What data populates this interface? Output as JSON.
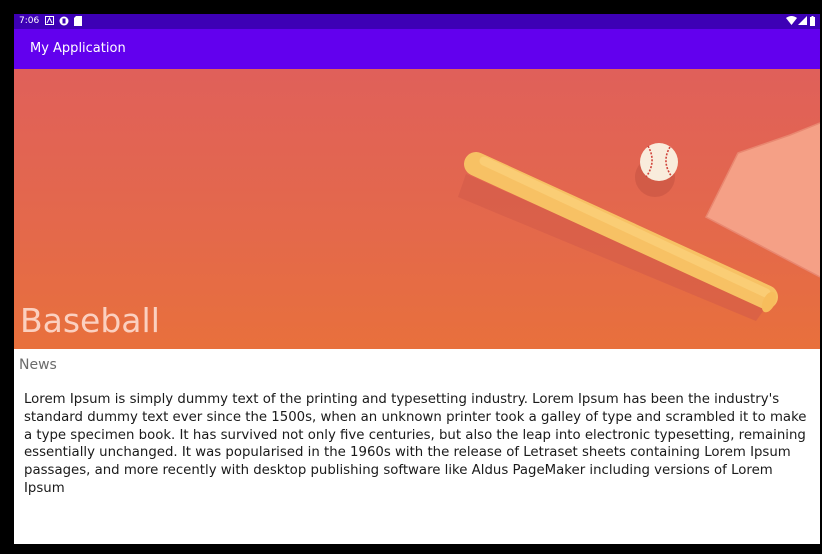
{
  "status_bar": {
    "time": "7:06",
    "left_icons": [
      "notification-icon",
      "media-icon",
      "sd-card-icon"
    ],
    "right_icons": [
      "wifi-icon",
      "signal-icon",
      "battery-icon"
    ]
  },
  "app_bar": {
    "title": "My Application"
  },
  "hero": {
    "title": "Baseball",
    "icons": [
      "baseball-bat-icon",
      "baseball-icon",
      "home-plate-icon"
    ]
  },
  "article": {
    "category": "News",
    "body": "Lorem Ipsum is simply dummy text of the printing and typesetting industry. Lorem Ipsum has been the industry's standard dummy text ever since the 1500s, when an unknown printer took a galley of type and scrambled it to make a type specimen book. It has survived not only five centuries, but also the leap into electronic typesetting, remaining essentially unchanged. It was popularised in the 1960s with the release of Letraset sheets containing Lorem Ipsum passages, and more recently with desktop publishing software like Aldus PageMaker including versions of Lorem Ipsum"
  },
  "colors": {
    "status_bar": "#3d00b5",
    "app_bar": "#6200ee",
    "hero_top": "#e0605a",
    "hero_bottom": "#e8703c",
    "hero_title": "#fbd0c0"
  }
}
